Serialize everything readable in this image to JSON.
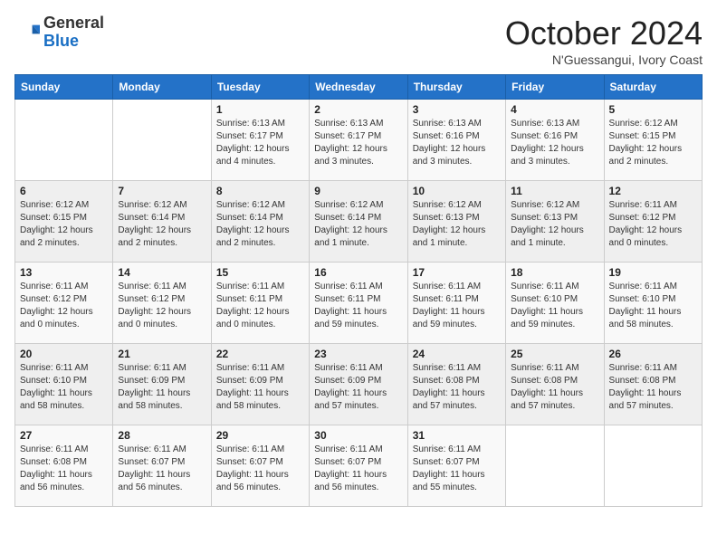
{
  "header": {
    "logo_general": "General",
    "logo_blue": "Blue",
    "month_title": "October 2024",
    "subtitle": "N'Guessangui, Ivory Coast"
  },
  "days_of_week": [
    "Sunday",
    "Monday",
    "Tuesday",
    "Wednesday",
    "Thursday",
    "Friday",
    "Saturday"
  ],
  "weeks": [
    [
      {
        "day": "",
        "info": ""
      },
      {
        "day": "",
        "info": ""
      },
      {
        "day": "1",
        "info": "Sunrise: 6:13 AM\nSunset: 6:17 PM\nDaylight: 12 hours and 4 minutes."
      },
      {
        "day": "2",
        "info": "Sunrise: 6:13 AM\nSunset: 6:17 PM\nDaylight: 12 hours and 3 minutes."
      },
      {
        "day": "3",
        "info": "Sunrise: 6:13 AM\nSunset: 6:16 PM\nDaylight: 12 hours and 3 minutes."
      },
      {
        "day": "4",
        "info": "Sunrise: 6:13 AM\nSunset: 6:16 PM\nDaylight: 12 hours and 3 minutes."
      },
      {
        "day": "5",
        "info": "Sunrise: 6:12 AM\nSunset: 6:15 PM\nDaylight: 12 hours and 2 minutes."
      }
    ],
    [
      {
        "day": "6",
        "info": "Sunrise: 6:12 AM\nSunset: 6:15 PM\nDaylight: 12 hours and 2 minutes."
      },
      {
        "day": "7",
        "info": "Sunrise: 6:12 AM\nSunset: 6:14 PM\nDaylight: 12 hours and 2 minutes."
      },
      {
        "day": "8",
        "info": "Sunrise: 6:12 AM\nSunset: 6:14 PM\nDaylight: 12 hours and 2 minutes."
      },
      {
        "day": "9",
        "info": "Sunrise: 6:12 AM\nSunset: 6:14 PM\nDaylight: 12 hours and 1 minute."
      },
      {
        "day": "10",
        "info": "Sunrise: 6:12 AM\nSunset: 6:13 PM\nDaylight: 12 hours and 1 minute."
      },
      {
        "day": "11",
        "info": "Sunrise: 6:12 AM\nSunset: 6:13 PM\nDaylight: 12 hours and 1 minute."
      },
      {
        "day": "12",
        "info": "Sunrise: 6:11 AM\nSunset: 6:12 PM\nDaylight: 12 hours and 0 minutes."
      }
    ],
    [
      {
        "day": "13",
        "info": "Sunrise: 6:11 AM\nSunset: 6:12 PM\nDaylight: 12 hours and 0 minutes."
      },
      {
        "day": "14",
        "info": "Sunrise: 6:11 AM\nSunset: 6:12 PM\nDaylight: 12 hours and 0 minutes."
      },
      {
        "day": "15",
        "info": "Sunrise: 6:11 AM\nSunset: 6:11 PM\nDaylight: 12 hours and 0 minutes."
      },
      {
        "day": "16",
        "info": "Sunrise: 6:11 AM\nSunset: 6:11 PM\nDaylight: 11 hours and 59 minutes."
      },
      {
        "day": "17",
        "info": "Sunrise: 6:11 AM\nSunset: 6:11 PM\nDaylight: 11 hours and 59 minutes."
      },
      {
        "day": "18",
        "info": "Sunrise: 6:11 AM\nSunset: 6:10 PM\nDaylight: 11 hours and 59 minutes."
      },
      {
        "day": "19",
        "info": "Sunrise: 6:11 AM\nSunset: 6:10 PM\nDaylight: 11 hours and 58 minutes."
      }
    ],
    [
      {
        "day": "20",
        "info": "Sunrise: 6:11 AM\nSunset: 6:10 PM\nDaylight: 11 hours and 58 minutes."
      },
      {
        "day": "21",
        "info": "Sunrise: 6:11 AM\nSunset: 6:09 PM\nDaylight: 11 hours and 58 minutes."
      },
      {
        "day": "22",
        "info": "Sunrise: 6:11 AM\nSunset: 6:09 PM\nDaylight: 11 hours and 58 minutes."
      },
      {
        "day": "23",
        "info": "Sunrise: 6:11 AM\nSunset: 6:09 PM\nDaylight: 11 hours and 57 minutes."
      },
      {
        "day": "24",
        "info": "Sunrise: 6:11 AM\nSunset: 6:08 PM\nDaylight: 11 hours and 57 minutes."
      },
      {
        "day": "25",
        "info": "Sunrise: 6:11 AM\nSunset: 6:08 PM\nDaylight: 11 hours and 57 minutes."
      },
      {
        "day": "26",
        "info": "Sunrise: 6:11 AM\nSunset: 6:08 PM\nDaylight: 11 hours and 57 minutes."
      }
    ],
    [
      {
        "day": "27",
        "info": "Sunrise: 6:11 AM\nSunset: 6:08 PM\nDaylight: 11 hours and 56 minutes."
      },
      {
        "day": "28",
        "info": "Sunrise: 6:11 AM\nSunset: 6:07 PM\nDaylight: 11 hours and 56 minutes."
      },
      {
        "day": "29",
        "info": "Sunrise: 6:11 AM\nSunset: 6:07 PM\nDaylight: 11 hours and 56 minutes."
      },
      {
        "day": "30",
        "info": "Sunrise: 6:11 AM\nSunset: 6:07 PM\nDaylight: 11 hours and 56 minutes."
      },
      {
        "day": "31",
        "info": "Sunrise: 6:11 AM\nSunset: 6:07 PM\nDaylight: 11 hours and 55 minutes."
      },
      {
        "day": "",
        "info": ""
      },
      {
        "day": "",
        "info": ""
      }
    ]
  ]
}
